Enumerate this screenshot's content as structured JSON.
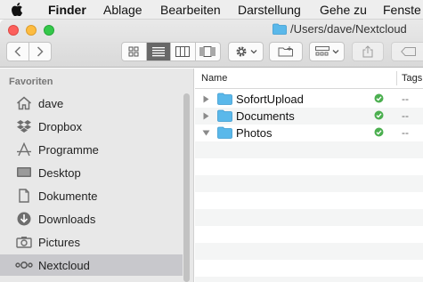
{
  "menubar": {
    "app": "Finder",
    "items": [
      "Ablage",
      "Bearbeiten",
      "Darstellung",
      "Gehe zu",
      "Fenste"
    ]
  },
  "window": {
    "title": "/Users/dave/Nextcloud"
  },
  "sidebar": {
    "section": "Favoriten",
    "items": [
      {
        "label": "dave",
        "icon": "home-icon"
      },
      {
        "label": "Dropbox",
        "icon": "dropbox-icon"
      },
      {
        "label": "Programme",
        "icon": "applications-icon"
      },
      {
        "label": "Desktop",
        "icon": "desktop-icon"
      },
      {
        "label": "Dokumente",
        "icon": "documents-icon"
      },
      {
        "label": "Downloads",
        "icon": "downloads-icon"
      },
      {
        "label": "Pictures",
        "icon": "camera-icon"
      },
      {
        "label": "Nextcloud",
        "icon": "nextcloud-icon",
        "selected": true
      }
    ]
  },
  "list": {
    "columns": {
      "name": "Name",
      "tags": "Tags"
    },
    "rows": [
      {
        "name": "SofortUpload",
        "expanded": false,
        "status": "synced",
        "tags": "--"
      },
      {
        "name": "Documents",
        "expanded": false,
        "status": "synced",
        "tags": "--"
      },
      {
        "name": "Photos",
        "expanded": true,
        "status": "synced",
        "tags": "--"
      }
    ]
  },
  "colors": {
    "folder": "#5ab8ea",
    "sync_ok": "#4caf50",
    "selection": "#c8c8cc"
  }
}
